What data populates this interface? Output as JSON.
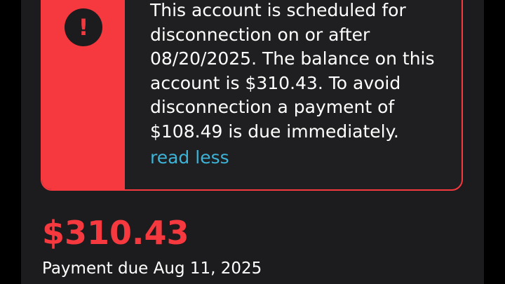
{
  "alert": {
    "icon": "exclamation-icon",
    "message": "This account is scheduled for disconnection on or after 08/20/2025. The balance on this account is $310.43. To avoid disconnection a payment of $108.49 is due immediately.",
    "read_less_label": "read less"
  },
  "balance": {
    "amount": "$310.43",
    "due_text": "Payment due Aug 11, 2025"
  },
  "colors": {
    "accent_red": "#f5393f",
    "link_blue": "#3db3d8",
    "background": "#1c1c1e"
  }
}
